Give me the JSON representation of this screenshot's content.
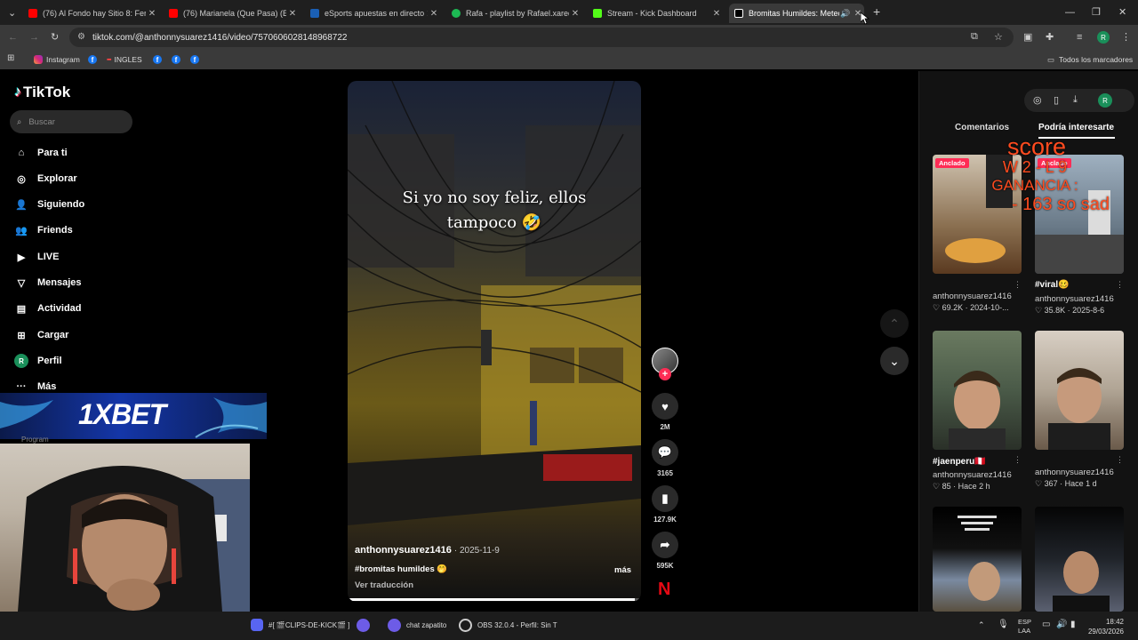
{
  "browser": {
    "tabs": [
      {
        "title": "(76) Al Fondo hay Sitio 8: Ferna",
        "color": "#ff0000"
      },
      {
        "title": "(76) Marianela (Que Pasa) (Exte",
        "color": "#ff0000"
      },
      {
        "title": "eSports apuestas en directo ➤",
        "color": "#1a5fb4"
      },
      {
        "title": "Rafa - playlist by Rafael.xared |",
        "color": "#1db954"
      },
      {
        "title": "Stream - Kick Dashboard",
        "color": "#53fc18"
      },
      {
        "title": "Bromitas Humildes: Meteo",
        "color": "#ffffff"
      }
    ],
    "new_tab": "+",
    "url": "tiktok.com/@anthonnysuarez1416/video/7570606028148968722",
    "bookmarks": [
      "Instagram",
      "INGLES"
    ],
    "all_bookmarks": "Todos los marcadores",
    "profile_initial": "R"
  },
  "tiktok": {
    "logo": "TikTok",
    "search_placeholder": "Buscar",
    "nav": [
      {
        "label": "Para ti",
        "icon": "home-icon"
      },
      {
        "label": "Explorar",
        "icon": "compass-icon"
      },
      {
        "label": "Siguiendo",
        "icon": "following-icon"
      },
      {
        "label": "Friends",
        "icon": "friends-icon"
      },
      {
        "label": "LIVE",
        "icon": "live-icon"
      },
      {
        "label": "Mensajes",
        "icon": "messages-icon"
      },
      {
        "label": "Actividad",
        "icon": "activity-icon"
      },
      {
        "label": "Cargar",
        "icon": "upload-icon"
      },
      {
        "label": "Perfil",
        "icon": "profile-icon"
      },
      {
        "label": "Más",
        "icon": "more-icon"
      }
    ],
    "profile_initial": "R",
    "video": {
      "caption": "Si yo no soy feliz, ellos tampoco 🤣",
      "author": "anthonnysuarez1416",
      "date": "· 2025-11-9",
      "hashtag": "#bromitas humildes 🤭",
      "more": "más",
      "translate": "Ver traducción"
    },
    "actions": {
      "likes": "2M",
      "comments": "3165",
      "saves": "127.9K",
      "shares": "595K"
    },
    "panel": {
      "tabs": [
        "Comentarios",
        "Podría interesarte"
      ],
      "active_tab": "Podría interesarte",
      "items": [
        {
          "badge": "Anclado",
          "title": "",
          "author": "anthonnysuarez1416",
          "likes": "69.2K",
          "date": "2024-10-..."
        },
        {
          "badge": "Anclado",
          "title": "#viral🥴",
          "author": "anthonnysuarez1416",
          "likes": "35.8K",
          "date": "2025-8-6"
        },
        {
          "badge": "",
          "title": "#jaenperu🇵🇪",
          "author": "anthonnysuarez1416",
          "likes": "85",
          "date": "Hace 2 h"
        },
        {
          "badge": "",
          "title": "",
          "author": "anthonnysuarez1416",
          "likes": "367",
          "date": "Hace 1 d"
        }
      ]
    }
  },
  "overlay": {
    "score_title": "score",
    "score_line1": "W 2 - L 9",
    "score_line2": "GANANCIA :",
    "score_line3": "- 163  so sad",
    "bet_brand": "1XBET",
    "program_label": "Program"
  },
  "taskbar": {
    "items": [
      "#[ 🎬CLIPS-DE-KICK🎬 ]",
      "chat zapatito",
      "OBS 32.0.4 - Perfil: Sin T"
    ],
    "lang": [
      "ESP",
      "LAA"
    ],
    "time": "18:42",
    "date": "29/03/2026"
  },
  "colors": {
    "accent_red": "#fe2c55",
    "overlay_orange": "#ff4b1f",
    "profile_green": "#1a8f5a"
  }
}
